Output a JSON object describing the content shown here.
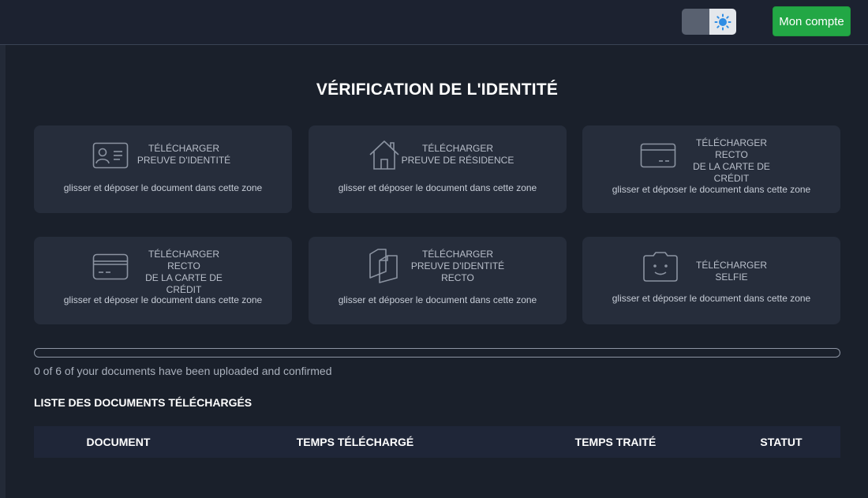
{
  "header": {
    "theme_toggle": {
      "dark_icon": "moon-icon",
      "light_icon": "sun-icon"
    },
    "account_button": "Mon compte"
  },
  "page": {
    "title": "VÉRIFICATION DE L'IDENTITÉ"
  },
  "upload_cards": [
    {
      "label": "TÉLÉCHARGER\nPREUVE D'IDENTITÉ",
      "hint": "glisser et déposer le document dans cette zone",
      "icon": "id-card-icon"
    },
    {
      "label": "TÉLÉCHARGER\nPREUVE DE RÉSIDENCE",
      "hint": "glisser et déposer le document dans cette zone",
      "icon": "house-icon"
    },
    {
      "label": "TÉLÉCHARGER RECTO\nDE LA CARTE DE\nCRÉDIT",
      "hint": "glisser et déposer le document dans cette zone",
      "icon": "credit-card-icon"
    },
    {
      "label": "TÉLÉCHARGER RECTO\nDE LA CARTE DE\nCRÉDIT",
      "hint": "glisser et déposer le document dans cette zone",
      "icon": "credit-card-icon"
    },
    {
      "label": "TÉLÉCHARGER\nPREUVE D'IDENTITÉ\nRECTO",
      "hint": "glisser et déposer le document dans cette zone",
      "icon": "documents-icon"
    },
    {
      "label": "TÉLÉCHARGER SELFIE",
      "hint": "glisser et déposer le document dans cette zone",
      "icon": "selfie-icon"
    }
  ],
  "progress": {
    "fraction": 0,
    "text": "0 of 6 of your documents have been uploaded and confirmed"
  },
  "documents": {
    "title": "LISTE DES DOCUMENTS TÉLÉCHARGÉS",
    "columns": [
      "DOCUMENT",
      "TEMPS TÉLÉCHARGÉ",
      "TEMPS TRAITÉ",
      "STATUT"
    ],
    "rows": []
  },
  "colors": {
    "accent_green": "#22a745",
    "background": "#1a202b",
    "card": "#262d3b"
  }
}
